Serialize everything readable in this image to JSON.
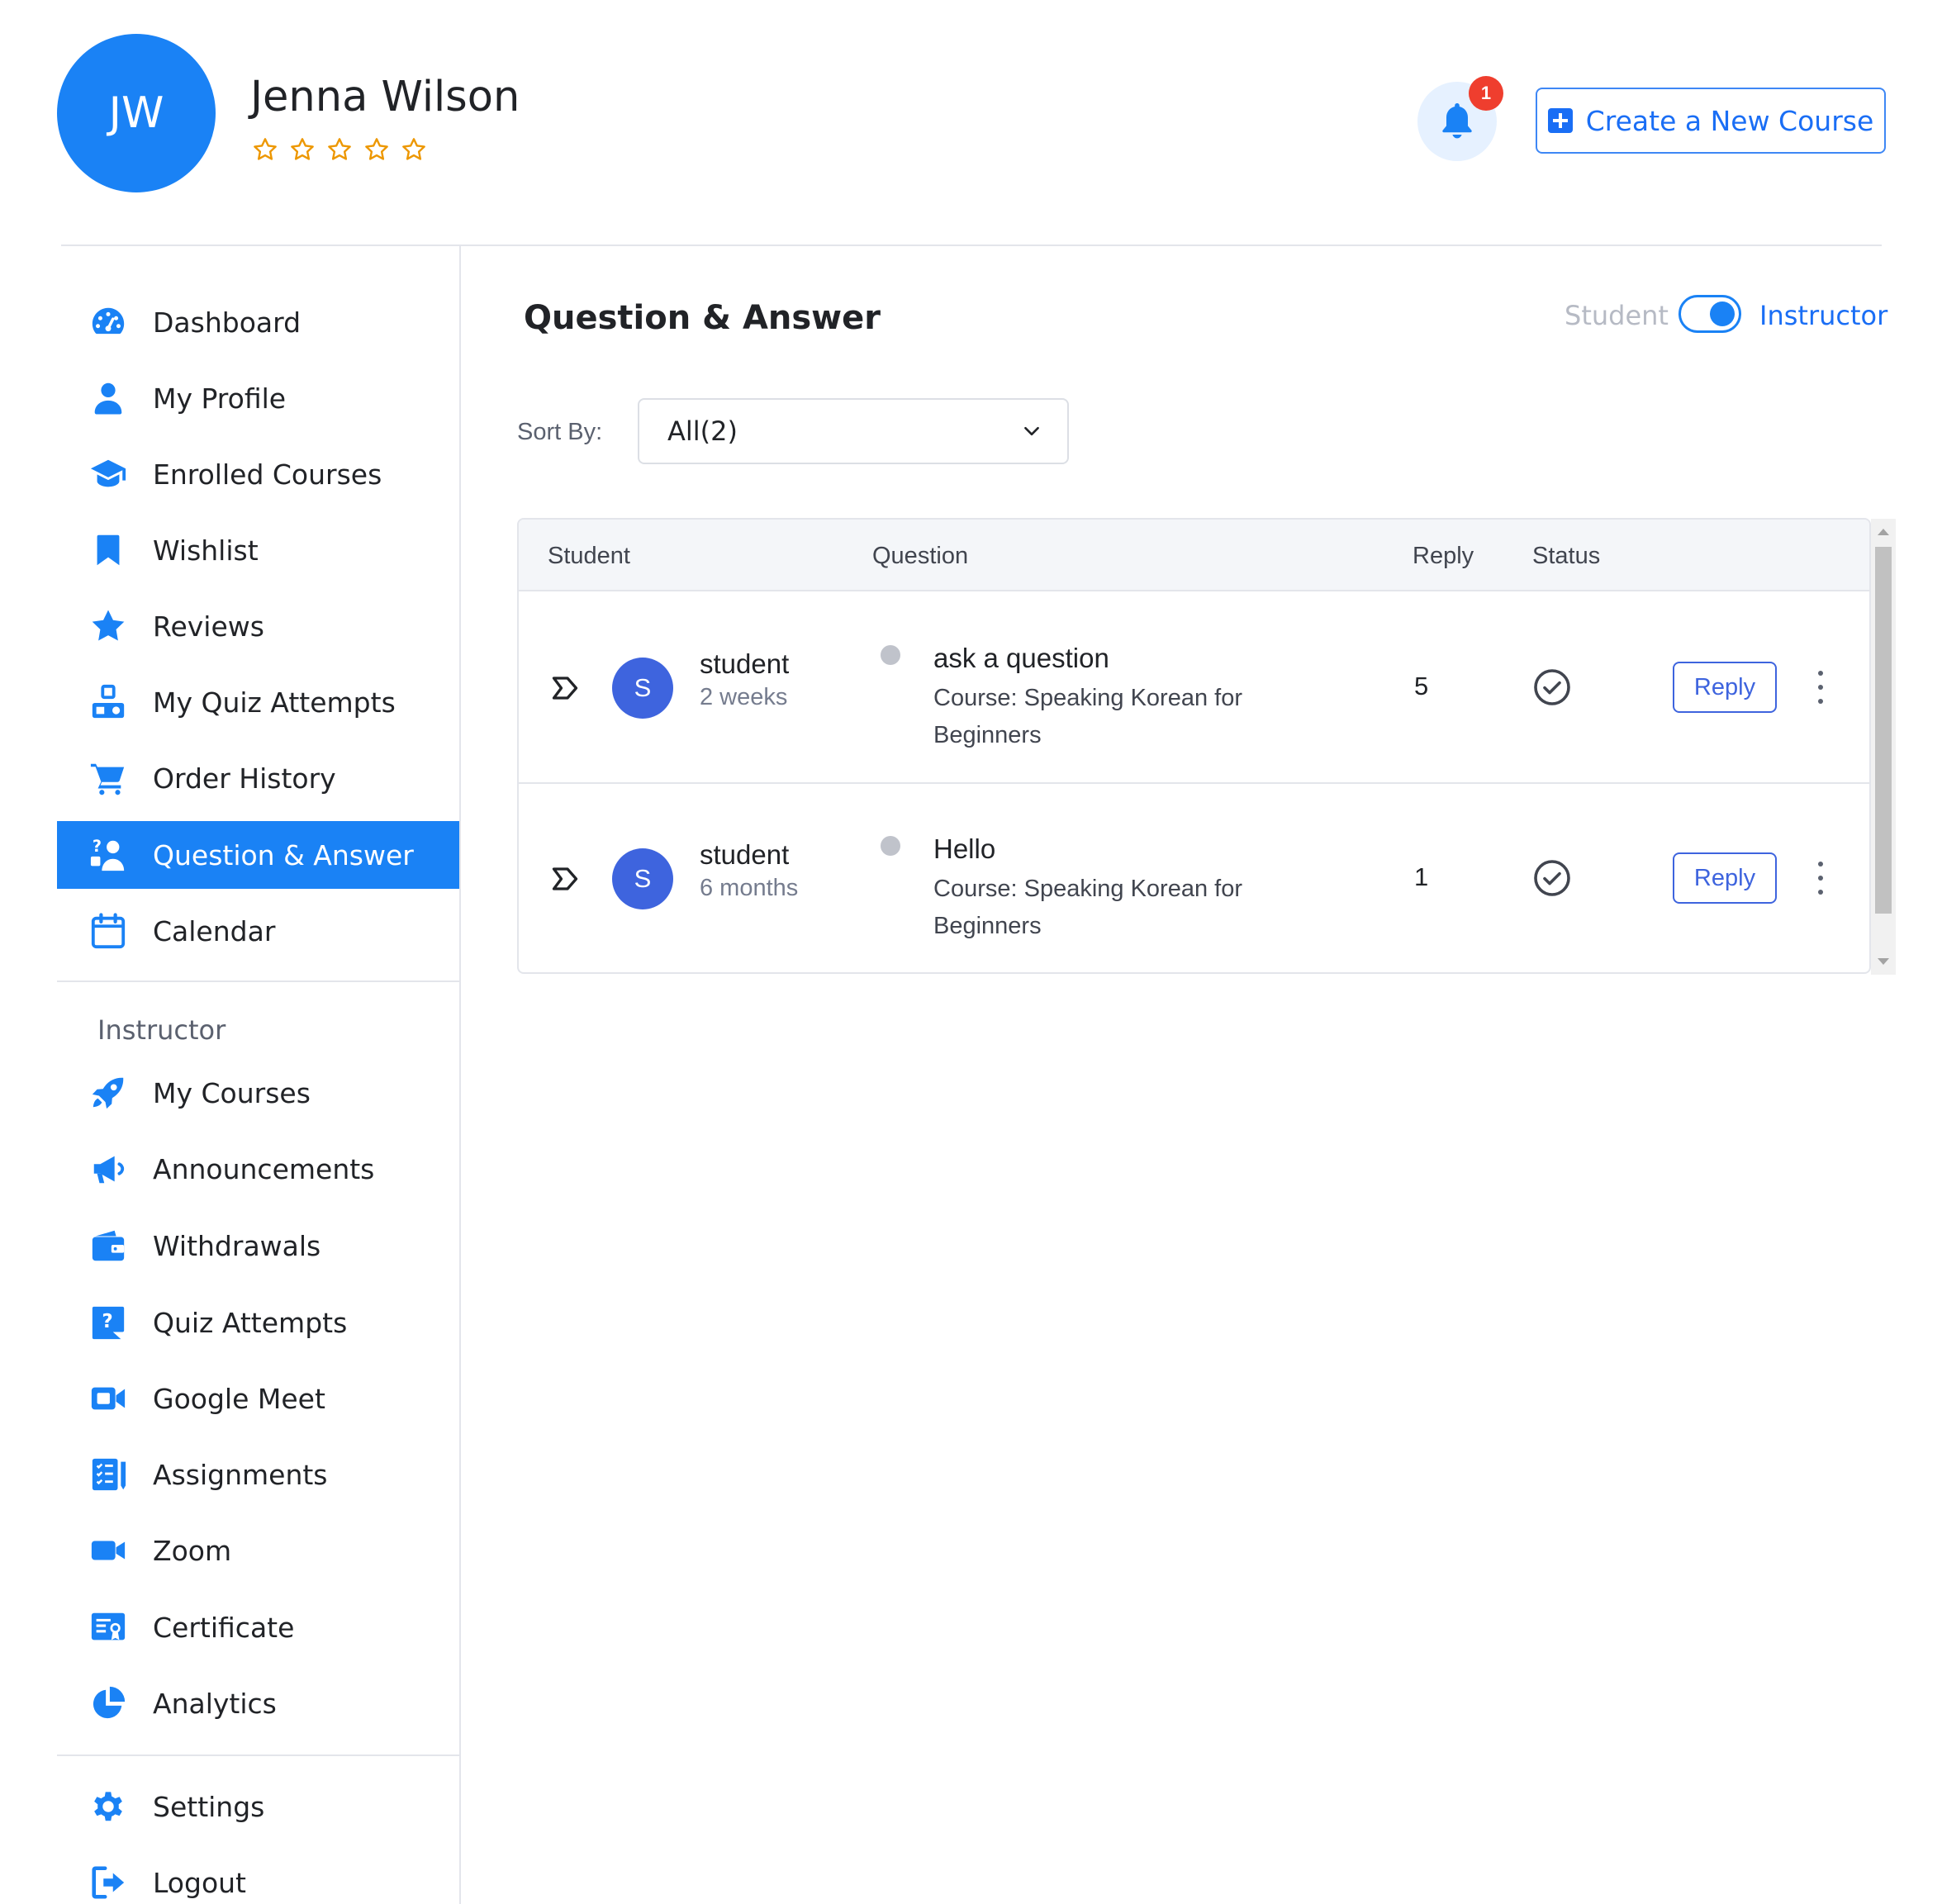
{
  "user": {
    "initials": "JW",
    "name": "Jenna Wilson",
    "rating_stars": 5
  },
  "notifications": {
    "count": "1",
    "icon": "bell-icon"
  },
  "header": {
    "create_course_label": "Create a New Course"
  },
  "sidebar": {
    "items": [
      {
        "label": "Dashboard",
        "icon": "dashboard-icon"
      },
      {
        "label": "My Profile",
        "icon": "user-icon"
      },
      {
        "label": "Enrolled Courses",
        "icon": "graduation-cap-icon"
      },
      {
        "label": "Wishlist",
        "icon": "bookmark-icon"
      },
      {
        "label": "Reviews",
        "icon": "star-icon"
      },
      {
        "label": "My Quiz Attempts",
        "icon": "quiz-attempts-icon"
      },
      {
        "label": "Order History",
        "icon": "cart-icon"
      },
      {
        "label": "Question & Answer",
        "icon": "question-answer-icon",
        "active": true
      },
      {
        "label": "Calendar",
        "icon": "calendar-icon"
      }
    ],
    "instructor_heading": "Instructor",
    "instructor_items": [
      {
        "label": "My Courses",
        "icon": "rocket-icon"
      },
      {
        "label": "Announcements",
        "icon": "megaphone-icon"
      },
      {
        "label": "Withdrawals",
        "icon": "wallet-icon"
      },
      {
        "label": "Quiz Attempts",
        "icon": "quiz-question-icon"
      },
      {
        "label": "Google Meet",
        "icon": "video-camera-icon"
      },
      {
        "label": "Assignments",
        "icon": "assignments-icon"
      },
      {
        "label": "Zoom",
        "icon": "zoom-camera-icon"
      },
      {
        "label": "Certificate",
        "icon": "certificate-icon"
      },
      {
        "label": "Analytics",
        "icon": "pie-chart-icon"
      }
    ],
    "footer_items": [
      {
        "label": "Settings",
        "icon": "gear-icon"
      },
      {
        "label": "Logout",
        "icon": "logout-icon"
      }
    ]
  },
  "main": {
    "title": "Question & Answer",
    "toggle": {
      "left_label": "Student",
      "right_label": "Instructor",
      "selected": "Instructor"
    },
    "sort": {
      "label": "Sort By:",
      "value": "All(2)"
    },
    "table": {
      "headers": {
        "student": "Student",
        "question": "Question",
        "reply": "Reply",
        "status": "Status"
      },
      "rows": [
        {
          "avatar": "S",
          "student": "student",
          "time": "2 weeks",
          "question": "ask a question",
          "course": "Course: Speaking Korean for Beginners",
          "replies": "5",
          "status": "answered",
          "reply_label": "Reply"
        },
        {
          "avatar": "S",
          "student": "student",
          "time": "6 months",
          "question": "Hello",
          "course": "Course: Speaking Korean for Beginners",
          "replies": "1",
          "status": "answered",
          "reply_label": "Reply"
        }
      ]
    }
  },
  "colors": {
    "primary": "#1a82f5",
    "accent": "#3e64de",
    "star": "#ed9700",
    "badge": "#ef3e2e"
  }
}
